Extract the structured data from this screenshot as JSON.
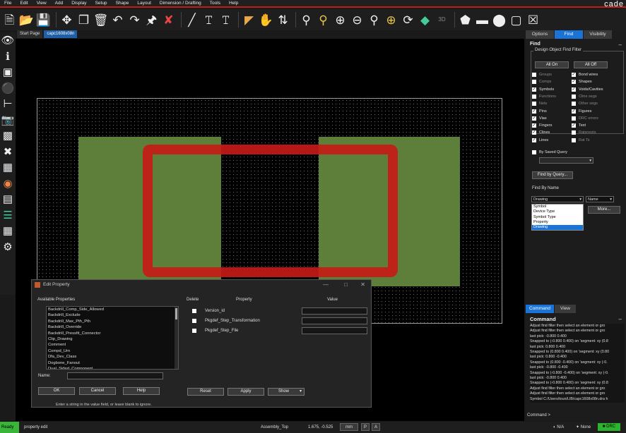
{
  "brand": "cade",
  "menu": [
    "File",
    "Edit",
    "View",
    "Add",
    "Display",
    "Setup",
    "Shape",
    "Layout",
    "Dimension / Drafting",
    "Tools",
    "Help"
  ],
  "toolbar_icons": [
    "new-file-icon",
    "open-folder-icon",
    "save-icon",
    "move-icon",
    "copy-icon",
    "delete-icon",
    "undo-icon",
    "redo-icon",
    "pin-icon",
    "unpin-icon",
    "line-icon",
    "text-add-icon",
    "text-edit-icon",
    "connect-icon",
    "fingers-icon",
    "flip-icon",
    "zoom-fit-icon",
    "zoom-in-icon",
    "zoom-in-plus-icon",
    "zoom-out-icon",
    "zoom-prev-icon",
    "zoom-world-icon",
    "refresh-icon",
    "3d-layer-icon",
    "3d-label",
    "shape-add-icon",
    "rect-add-icon",
    "circle-add-icon",
    "select-icon",
    "close-x-icon"
  ],
  "tabs": {
    "start": "Start Page",
    "file": "capc1608x08n"
  },
  "right_panel": {
    "tabs": [
      "Options",
      "Find",
      "Visibility"
    ],
    "find_title": "Find",
    "filter_legend": "Design Object Find Filter",
    "all_on": "All On",
    "all_off": "All Off",
    "filters_left": [
      {
        "label": "Groups",
        "checked": false,
        "dim": true
      },
      {
        "label": "Comps",
        "checked": false,
        "dim": true
      },
      {
        "label": "Symbols",
        "checked": true,
        "dim": false
      },
      {
        "label": "Functions",
        "checked": false,
        "dim": true
      },
      {
        "label": "Nets",
        "checked": false,
        "dim": true
      },
      {
        "label": "Pins",
        "checked": true,
        "dim": false
      },
      {
        "label": "Vias",
        "checked": true,
        "dim": false
      },
      {
        "label": "Fingers",
        "checked": true,
        "dim": false
      },
      {
        "label": "Clines",
        "checked": true,
        "dim": false
      },
      {
        "label": "Lines",
        "checked": true,
        "dim": false
      }
    ],
    "filters_right": [
      {
        "label": "Bond wires",
        "checked": true,
        "dim": false
      },
      {
        "label": "Shapes",
        "checked": true,
        "dim": false
      },
      {
        "label": "Voids/Cavities",
        "checked": true,
        "dim": false
      },
      {
        "label": "Cline segs",
        "checked": false,
        "dim": true
      },
      {
        "label": "Other segs",
        "checked": false,
        "dim": true
      },
      {
        "label": "Figures",
        "checked": true,
        "dim": false
      },
      {
        "label": "DRC errors",
        "checked": false,
        "dim": true
      },
      {
        "label": "Text",
        "checked": true,
        "dim": false
      },
      {
        "label": "Ratsnests",
        "checked": false,
        "dim": true
      },
      {
        "label": "Rat Ts",
        "checked": false,
        "dim": true
      }
    ],
    "by_saved_query": "By Saved Query",
    "find_by_query": "Find by Query...",
    "find_by_name": "Find By Name",
    "name_combo": "Drawing",
    "name_type": "Name",
    "more": "More...",
    "dropdown_options": [
      "Symbol",
      "Device Type",
      "Symbol Type",
      "Property",
      "Drawing"
    ],
    "dropdown_selected": "Drawing",
    "cmd_tabs": [
      "Command",
      "View"
    ],
    "command_title": "Command",
    "command_lines": [
      "Adjust find filter then select an element or gro",
      "Adjust find filter then select an element or gro",
      "last pick:  -0.800 0.400",
      "Snapped to (-0.800 0.400) on 'segment: xy (0.8",
      "last pick:  0.800 0.400",
      "Snapped to (0.800 0.400) on 'segment: xy (0.80",
      "last pick:  0.800 -0.400",
      "Snapped to (0.800 -0.400) on 'segment: xy (-0.",
      "last pick:  -0.800 -0.400",
      "Snapped to (-0.800 -0.400) on 'segment: xy (-0.",
      "last pick:  -0.800 0.400",
      "Snapped to (-0.800 0.400) on 'segment: xy (0.8",
      "Adjust find filter then select an element or gro",
      "Adjust find filter then select an element or gro",
      "Symbol C:/Users/toun/LIB/capc1608x08n.dra h"
    ],
    "command_prompt": "Command >"
  },
  "dialog": {
    "title": "Edit Property",
    "available_label": "Available Properties",
    "properties": [
      "Backdrill_Comp_Side_Allowed",
      "Backdrill_Exclude",
      "Backdrill_Max_Pth_Pth",
      "Backdrill_Override",
      "Backdrill_Pressfit_Connector",
      "Clip_Drawing",
      "Comment",
      "Compd_Urn",
      "Dfa_Dev_Class",
      "Dogbone_Fanout",
      "Dual_Sided_Component"
    ],
    "name_label": "Name:",
    "col_delete": "Delete",
    "col_property": "Property",
    "col_value": "Value",
    "rows": [
      "Version_id",
      "Pkgdef_Step_Transformation",
      "Pkgdef_Step_File"
    ],
    "ok": "OK",
    "cancel": "Cancel",
    "help": "Help",
    "reset": "Reset",
    "apply": "Apply",
    "show": "Show",
    "hint": "Enter a string in the value field, or leave blank to ignore."
  },
  "status": {
    "ready": "Ready",
    "mode": "property edit",
    "layer": "Assembly_Top",
    "coords": "1.675, -0.525",
    "units": "mm",
    "p_btn": "P",
    "a_btn": "A",
    "na": "N/A",
    "none": "None",
    "drc": "DRC"
  },
  "colors": {
    "accent": "#1a74d8",
    "copper": "#5e7f3a",
    "ring": "#c81a16",
    "drc": "#2db42d"
  }
}
